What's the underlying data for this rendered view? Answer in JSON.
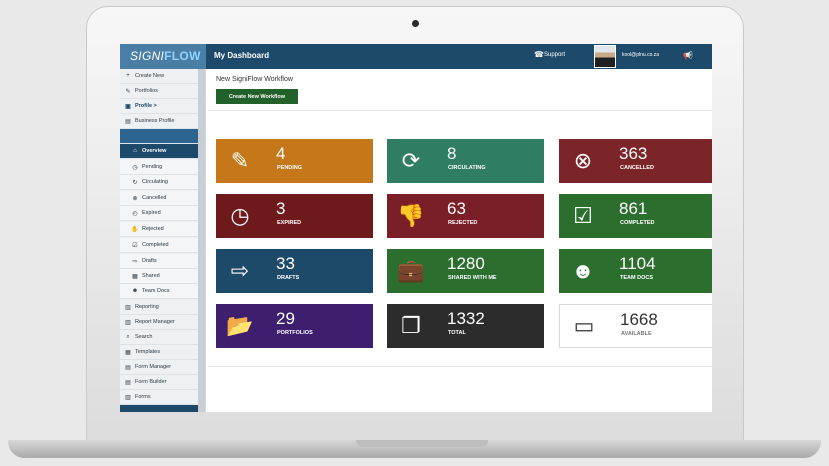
{
  "header": {
    "logo_prefix": "SIGNI",
    "logo_suffix": "FLOW",
    "title": "My Dashboard",
    "support": "Support",
    "user_email": "kool@plnu.co.za"
  },
  "sidebar": {
    "items": [
      {
        "label": "Create New",
        "icon": "plus-icon"
      },
      {
        "label": "Portfolios",
        "icon": "pencil-icon"
      },
      {
        "label": "Profile >",
        "icon": "profile-icon"
      },
      {
        "label": "Business Profile",
        "icon": "document-icon"
      },
      {
        "label": "",
        "icon": "folder-icon"
      },
      {
        "label": "Overview",
        "icon": "home-icon"
      },
      {
        "label": "Pending",
        "icon": "clock-icon"
      },
      {
        "label": "Circulating",
        "icon": "refresh-icon"
      },
      {
        "label": "Cancelled",
        "icon": "cancel-icon"
      },
      {
        "label": "Expired",
        "icon": "timer-icon"
      },
      {
        "label": "Rejected",
        "icon": "reject-icon"
      },
      {
        "label": "Completed",
        "icon": "check-icon"
      },
      {
        "label": "Drafts",
        "icon": "draft-icon"
      },
      {
        "label": "Shared",
        "icon": "share-icon"
      },
      {
        "label": "Team Docs",
        "icon": "team-icon"
      },
      {
        "label": "Reporting",
        "icon": "report-icon"
      },
      {
        "label": "Report Manager",
        "icon": "report-manager-icon"
      },
      {
        "label": "Search",
        "icon": "search-icon"
      },
      {
        "label": "Templates",
        "icon": "templates-icon"
      },
      {
        "label": "Form Manager",
        "icon": "form-manager-icon"
      },
      {
        "label": "Form Builder",
        "icon": "form-builder-icon"
      },
      {
        "label": "Forms",
        "icon": "forms-icon"
      }
    ]
  },
  "main": {
    "section_title": "New SigniFlow Workflow",
    "create_button": "Create New Workflow"
  },
  "tiles": [
    {
      "count": "4",
      "label": "PENDING",
      "color": "#c5771a",
      "icon": "edit-icon"
    },
    {
      "count": "8",
      "label": "CIRCULATING",
      "color": "#2f7d62",
      "icon": "refresh-icon"
    },
    {
      "count": "363",
      "label": "CANCELLED",
      "color": "#7c2528",
      "icon": "cancel-circle-icon"
    },
    {
      "count": "3",
      "label": "EXPIRED",
      "color": "#6e1a1c",
      "icon": "clock-icon"
    },
    {
      "count": "63",
      "label": "REJECTED",
      "color": "#7a1e27",
      "icon": "thumbs-down-icon"
    },
    {
      "count": "861",
      "label": "COMPLETED",
      "color": "#2b6e2e",
      "icon": "check-square-icon"
    },
    {
      "count": "33",
      "label": "DRAFTS",
      "color": "#1e4a6a",
      "icon": "export-icon"
    },
    {
      "count": "1280",
      "label": "SHARED WITH ME",
      "color": "#2b6e2e",
      "icon": "briefcase-icon"
    },
    {
      "count": "1104",
      "label": "TEAM DOCS",
      "color": "#2b6e2e",
      "icon": "team-icon"
    },
    {
      "count": "29",
      "label": "PORTFOLIOS",
      "color": "#3e1e6e",
      "icon": "folder-open-icon"
    },
    {
      "count": "1332",
      "label": "TOTAL",
      "color": "#2c2c2c",
      "icon": "copy-icon"
    },
    {
      "count": "1668",
      "label": "AVAILABLE",
      "color": "#ffffff",
      "icon": "drive-icon"
    }
  ]
}
